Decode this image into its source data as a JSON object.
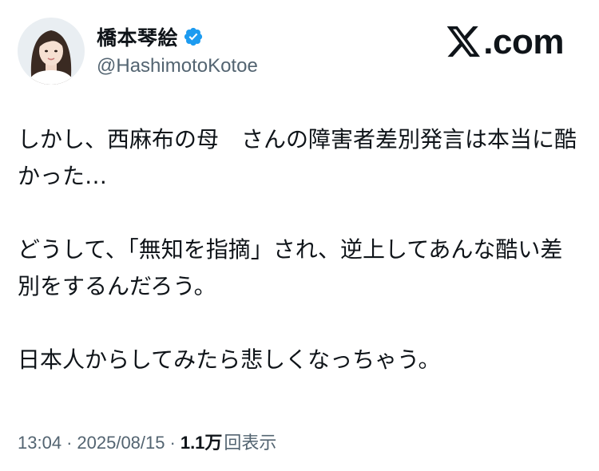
{
  "author": {
    "display_name": "橋本琴絵",
    "handle": "@HashimotoKotoe",
    "verified": true
  },
  "brand": {
    "suffix": ".com"
  },
  "tweet": {
    "paragraphs": [
      "しかし、西麻布の母　さんの障害者差別発言は本当に酷かった…",
      "どうして、「無知を指摘」され、逆上してあんな酷い差別をするんだろう。",
      "日本人からしてみたら悲しくなっちゃう。"
    ]
  },
  "meta": {
    "time": "13:04",
    "date": "2025/08/15",
    "separator": "·",
    "views_count": "1.1万",
    "views_label": "回表示"
  },
  "colors": {
    "text": "#0f1419",
    "secondary": "#536471",
    "verified": "#1d9bf0",
    "background": "#ffffff"
  },
  "icons": {
    "verified": "verified-badge-icon",
    "brand": "x-logo-icon"
  }
}
